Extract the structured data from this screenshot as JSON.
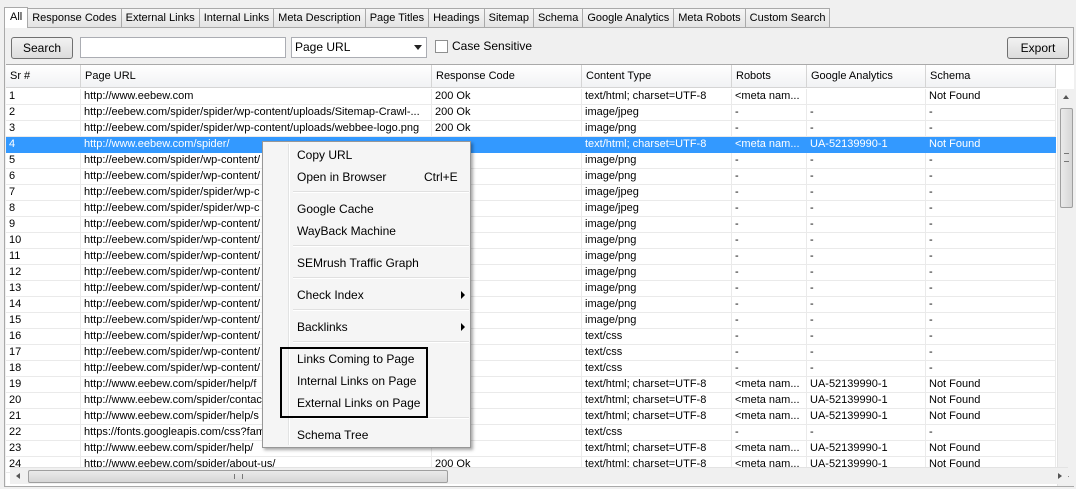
{
  "tabs": [
    "All",
    "Response Codes",
    "External Links",
    "Internal Links",
    "Meta Description",
    "Page Titles",
    "Headings",
    "Sitemap",
    "Schema",
    "Google Analytics",
    "Meta Robots",
    "Custom Search"
  ],
  "toolbar": {
    "search_label": "Search",
    "search_value": "",
    "field_select_value": "Page URL",
    "case_sensitive_label": "Case Sensitive",
    "case_sensitive_checked": false,
    "export_label": "Export"
  },
  "table": {
    "columns": [
      "Sr #",
      "Page URL",
      "Response Code",
      "Content Type",
      "Robots",
      "Google Analytics",
      "Schema"
    ],
    "selected_row": 4,
    "rows": [
      [
        "1",
        "http://www.eebew.com",
        "200 Ok",
        "text/html; charset=UTF-8",
        "<meta nam...",
        "",
        "Not Found"
      ],
      [
        "2",
        "http://eebew.com/spider/spider/wp-content/uploads/Sitemap-Crawl-...",
        "200 Ok",
        "image/jpeg",
        "-",
        "-",
        "-"
      ],
      [
        "3",
        "http://eebew.com/spider/spider/wp-content/uploads/webbee-logo.png",
        "200 Ok",
        "image/png",
        "-",
        "-",
        "-"
      ],
      [
        "4",
        "http://www.eebew.com/spider/",
        "",
        "text/html; charset=UTF-8",
        "<meta nam...",
        "UA-52139990-1",
        "Not Found"
      ],
      [
        "5",
        "http://eebew.com/spider/wp-content/",
        "",
        "image/png",
        "-",
        "-",
        "-"
      ],
      [
        "6",
        "http://eebew.com/spider/wp-content/",
        "",
        "image/png",
        "-",
        "-",
        "-"
      ],
      [
        "7",
        "http://eebew.com/spider/spider/wp-c",
        "",
        "image/jpeg",
        "-",
        "-",
        "-"
      ],
      [
        "8",
        "http://eebew.com/spider/spider/wp-c",
        "",
        "image/jpeg",
        "-",
        "-",
        "-"
      ],
      [
        "9",
        "http://eebew.com/spider/wp-content/",
        "",
        "image/png",
        "-",
        "-",
        "-"
      ],
      [
        "10",
        "http://eebew.com/spider/wp-content/",
        "",
        "image/png",
        "-",
        "-",
        "-"
      ],
      [
        "11",
        "http://eebew.com/spider/wp-content/",
        "",
        "image/png",
        "-",
        "-",
        "-"
      ],
      [
        "12",
        "http://eebew.com/spider/wp-content/",
        "",
        "image/png",
        "-",
        "-",
        "-"
      ],
      [
        "13",
        "http://eebew.com/spider/wp-content/",
        "",
        "image/png",
        "-",
        "-",
        "-"
      ],
      [
        "14",
        "http://eebew.com/spider/wp-content/",
        "",
        "image/png",
        "-",
        "-",
        "-"
      ],
      [
        "15",
        "http://eebew.com/spider/wp-content/",
        "",
        "image/png",
        "-",
        "-",
        "-"
      ],
      [
        "16",
        "http://eebew.com/spider/wp-content/",
        "",
        "text/css",
        "-",
        "-",
        "-"
      ],
      [
        "17",
        "http://eebew.com/spider/wp-content/",
        "",
        "text/css",
        "-",
        "-",
        "-"
      ],
      [
        "18",
        "http://eebew.com/spider/wp-content/",
        "",
        "text/css",
        "-",
        "-",
        "-"
      ],
      [
        "19",
        "http://www.eebew.com/spider/help/f",
        "",
        "text/html; charset=UTF-8",
        "<meta nam...",
        "UA-52139990-1",
        "Not Found"
      ],
      [
        "20",
        "http://www.eebew.com/spider/contac",
        "",
        "text/html; charset=UTF-8",
        "<meta nam...",
        "UA-52139990-1",
        "Not Found"
      ],
      [
        "21",
        "http://www.eebew.com/spider/help/s",
        "",
        "text/html; charset=UTF-8",
        "<meta nam...",
        "UA-52139990-1",
        "Not Found"
      ],
      [
        "22",
        "https://fonts.googleapis.com/css?fam",
        "",
        "text/css",
        "-",
        "-",
        "-"
      ],
      [
        "23",
        "http://www.eebew.com/spider/help/",
        "",
        "text/html; charset=UTF-8",
        "<meta nam...",
        "UA-52139990-1",
        "Not Found"
      ],
      [
        "24",
        "http://www.eebew.com/spider/about-us/",
        "200 Ok",
        "text/html; charset=UTF-8",
        "<meta nam...",
        "UA-52139990-1",
        "Not Found"
      ]
    ]
  },
  "context_menu": {
    "items": [
      {
        "label": "Copy URL"
      },
      {
        "label": "Open in Browser",
        "shortcut": "Ctrl+E"
      },
      {
        "label": "Google Cache"
      },
      {
        "label": "WayBack Machine"
      },
      {
        "label": "SEMrush Traffic Graph"
      },
      {
        "label": "Check Index",
        "submenu": true
      },
      {
        "label": "Backlinks",
        "submenu": true
      },
      {
        "label": "Links Coming to Page"
      },
      {
        "label": "Internal Links on Page"
      },
      {
        "label": "External Links on Page"
      },
      {
        "label": "Schema Tree"
      }
    ]
  },
  "colors": {
    "selection": "#3399ff",
    "highlight_box": "#000000"
  }
}
